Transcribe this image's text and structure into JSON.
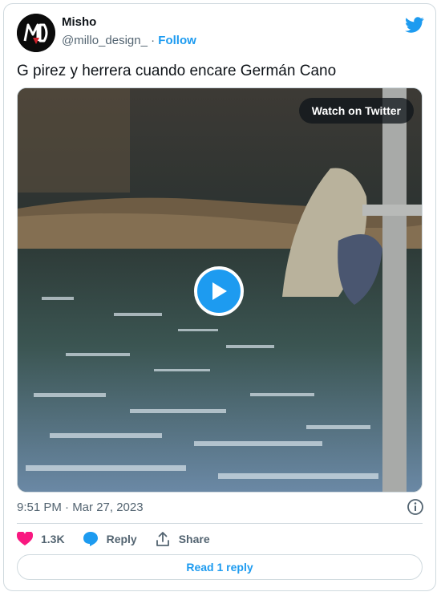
{
  "author": {
    "name": "Misho",
    "handle": "@millo_design_",
    "separator": "·",
    "follow_label": "Follow",
    "avatar_text": "MD"
  },
  "tweet": {
    "text": "G pirez y herrera cuando encare Germán Cano",
    "timestamp": "9:51 PM · Mar 27, 2023"
  },
  "media": {
    "watch_label": "Watch on Twitter"
  },
  "actions": {
    "like_count": "1.3K",
    "reply_label": "Reply",
    "share_label": "Share",
    "read_replies_label": "Read 1 reply"
  },
  "colors": {
    "accent": "#1d9bf0",
    "like": "#f91880",
    "muted": "#536471",
    "border": "#cfd9de"
  }
}
